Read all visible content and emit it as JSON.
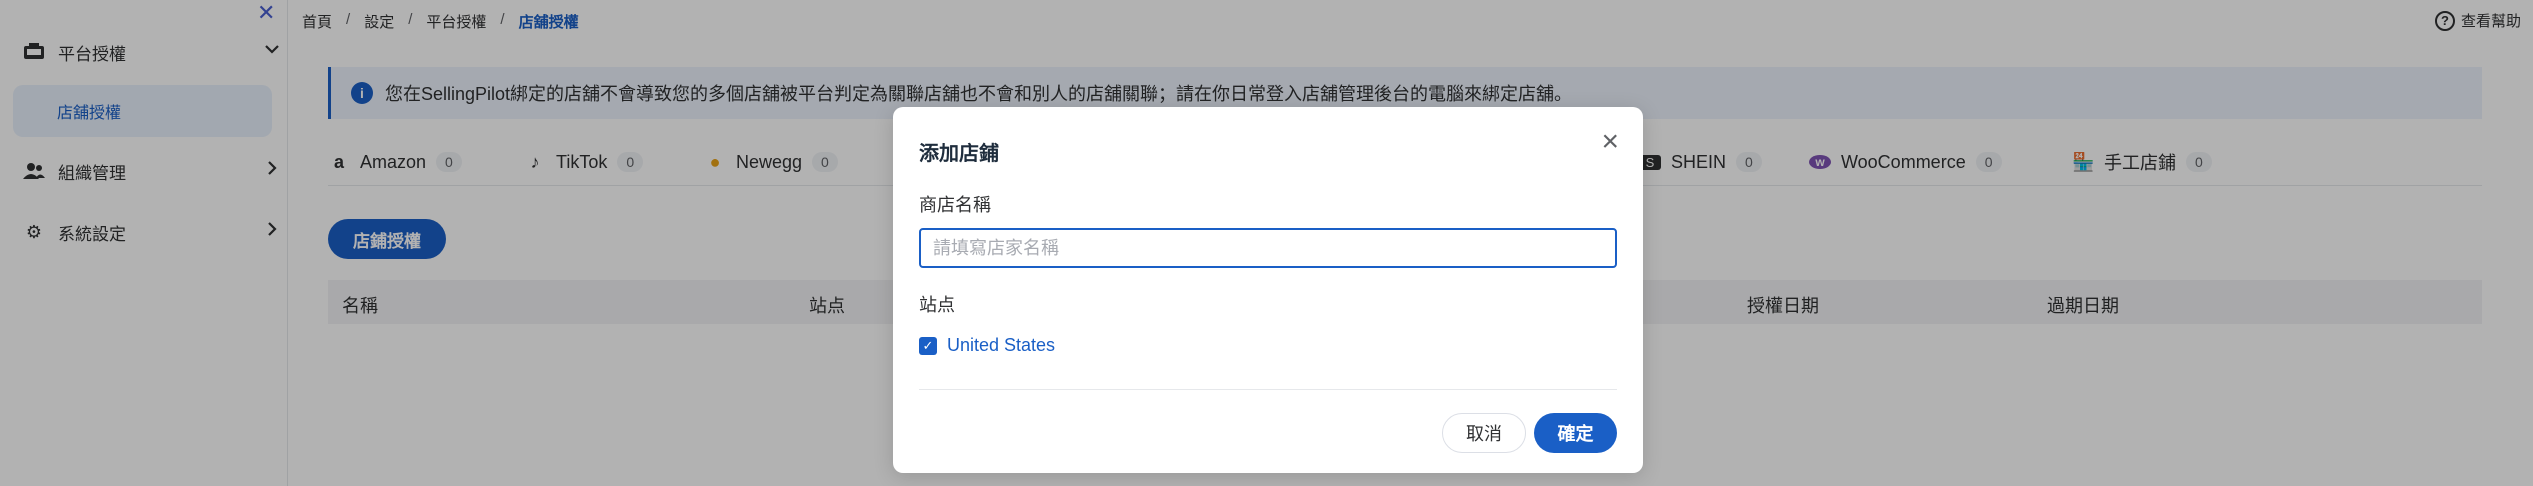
{
  "sidebar": {
    "close_icon": "close-icon",
    "groups": [
      {
        "label": "平台授權",
        "icon": "platform-icon",
        "expanded": true
      },
      {
        "label": "組織管理",
        "icon": "users-icon",
        "expanded": false
      },
      {
        "label": "系統設定",
        "icon": "gear-icon",
        "expanded": false
      }
    ],
    "active_item": "店舖授權"
  },
  "breadcrumb": [
    "首頁",
    "設定",
    "平台授權",
    "店舖授權"
  ],
  "help_label": "查看幫助",
  "notice": "您在SellingPilot綁定的店舖不會導致您的多個店舖被平台判定為關聯店舖也不會和別人的店舖關聯；請在你日常登入店舖管理後台的電腦來綁定店舖。",
  "tabs": [
    {
      "label": "Amazon",
      "count": "0",
      "icon": "amazon-icon"
    },
    {
      "label": "TikTok",
      "count": "0",
      "icon": "tiktok-icon"
    },
    {
      "label": "Newegg",
      "count": "0",
      "icon": "newegg-icon"
    },
    {
      "label": "SHEIN",
      "count": "0",
      "icon": "shein-icon"
    },
    {
      "label": "WooCommerce",
      "count": "0",
      "icon": "woocommerce-icon"
    },
    {
      "label": "手工店鋪",
      "count": "0",
      "icon": "manual-store-icon"
    }
  ],
  "authorize_button": "店鋪授權",
  "table_headers": [
    "名稱",
    "站点",
    "授權日期",
    "過期日期"
  ],
  "modal": {
    "title": "添加店鋪",
    "store_name_label": "商店名稱",
    "store_name_placeholder": "請填寫店家名稱",
    "store_name_value": "",
    "site_label": "站点",
    "site_option": "United States",
    "site_checked": true,
    "cancel_label": "取消",
    "ok_label": "確定"
  },
  "colors": {
    "primary": "#1a5fc6",
    "notice_bg": "#ecf3fd"
  }
}
